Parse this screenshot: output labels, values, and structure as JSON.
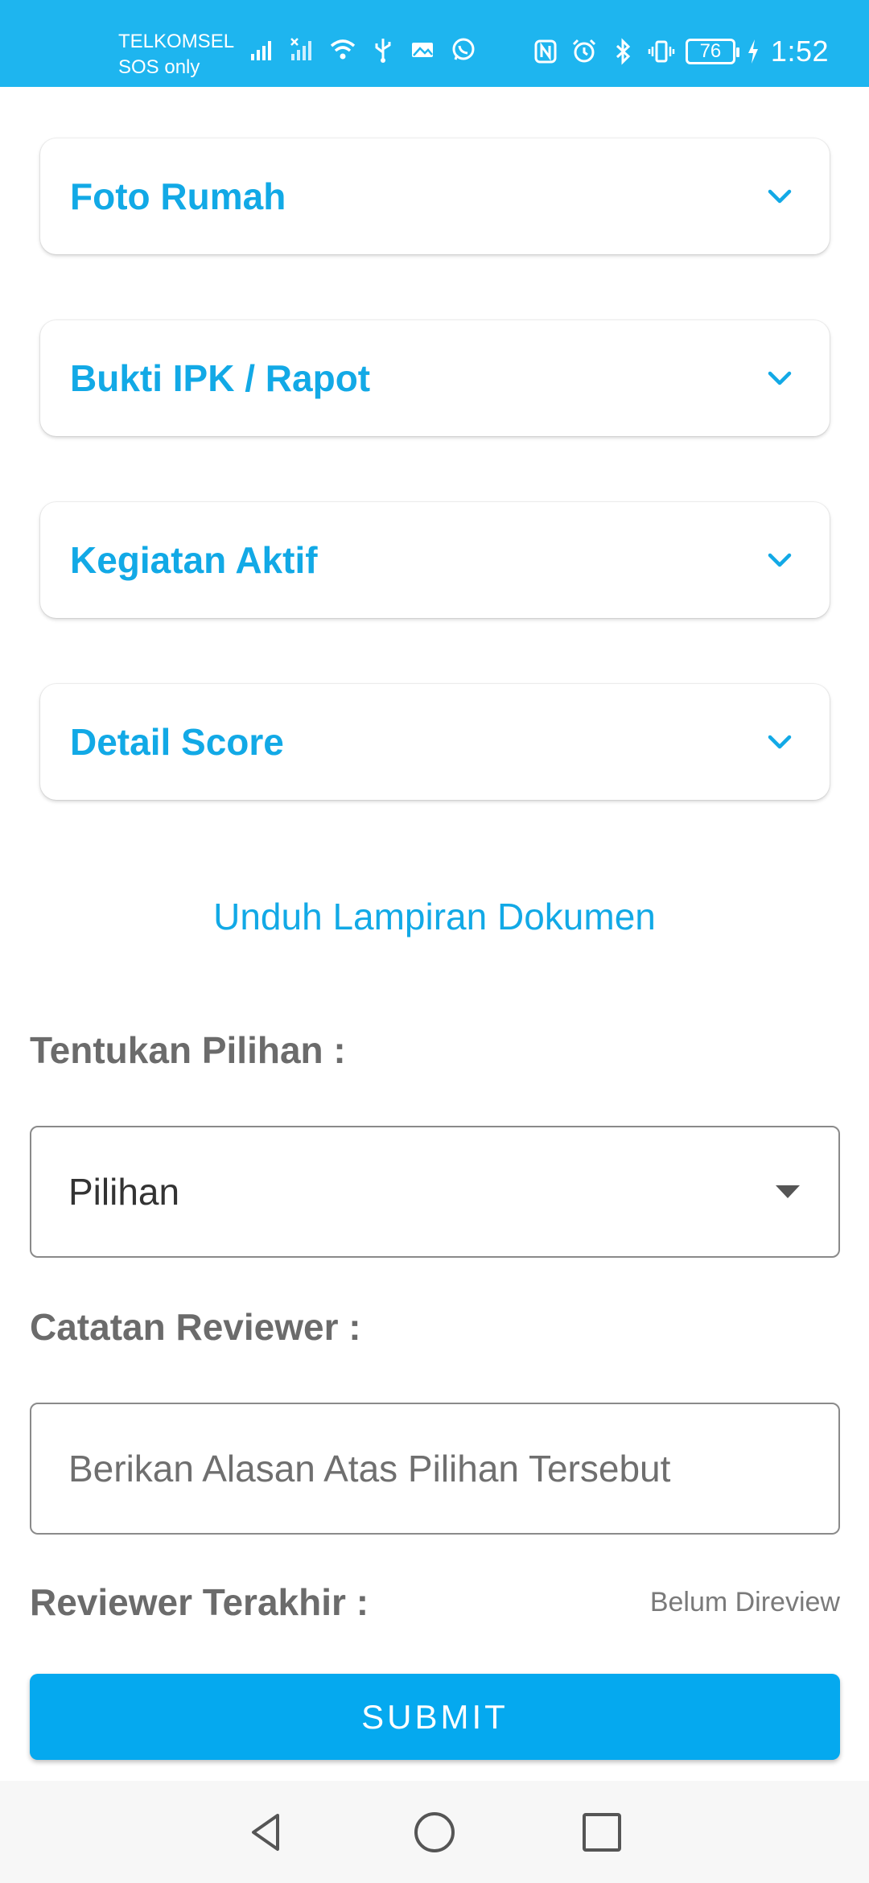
{
  "status_bar": {
    "carrier": "TELKOMSEL",
    "carrier_sub": "SOS only",
    "battery": "76",
    "time": "1:52",
    "icons_left": [
      "signal-icon",
      "signal-no-sim-icon",
      "wifi-icon",
      "usb-icon",
      "image-notification-icon",
      "whatsapp-icon"
    ],
    "icons_right": [
      "nfc-icon",
      "alarm-icon",
      "bluetooth-icon",
      "vibrate-icon",
      "battery-icon",
      "charging-icon"
    ]
  },
  "accordions": [
    {
      "title": "Foto Rumah"
    },
    {
      "title": "Bukti IPK / Rapot"
    },
    {
      "title": "Kegiatan Aktif"
    },
    {
      "title": "Detail Score"
    }
  ],
  "download_link": "Unduh Lampiran Dokumen",
  "choice": {
    "label": "Tentukan Pilihan :",
    "selected": "Pilihan"
  },
  "notes": {
    "label": "Catatan Reviewer :",
    "placeholder": "Berikan Alasan Atas Pilihan Tersebut"
  },
  "last_reviewer": {
    "label": "Reviewer Terakhir :",
    "value": "Belum Direview"
  },
  "submit_label": "SUBMIT",
  "nav": [
    "back-icon",
    "home-icon",
    "recents-icon"
  ],
  "colors": {
    "accent": "#12a9e6",
    "status_bar": "#1eb5ef",
    "button": "#05a9ef"
  }
}
